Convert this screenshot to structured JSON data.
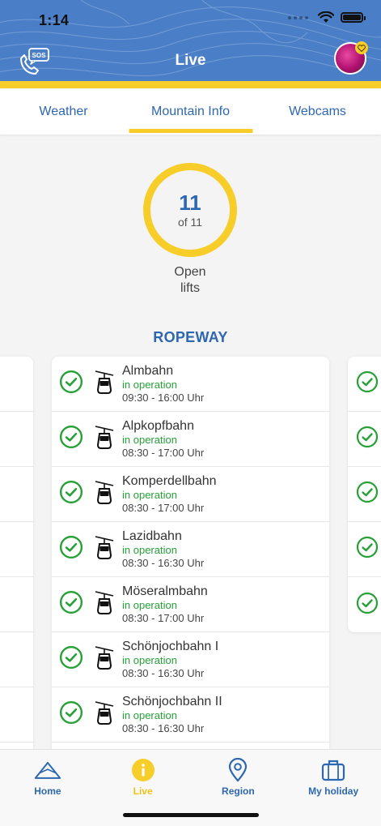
{
  "status_bar": {
    "time": "1:14"
  },
  "header": {
    "title": "Live",
    "sos_label": "SOS"
  },
  "tabs": [
    {
      "label": "Weather"
    },
    {
      "label": "Mountain Info"
    },
    {
      "label": "Webcams"
    }
  ],
  "summary": {
    "open_count": "11",
    "total_text": "of 11",
    "label_line1": "Open",
    "label_line2": "lifts"
  },
  "section": {
    "title": "ROPEWAY"
  },
  "lifts": [
    {
      "name": "Almbahn",
      "status": "in operation",
      "hours": "09:30 - 16:00 Uhr"
    },
    {
      "name": "Alpkopfbahn",
      "status": "in operation",
      "hours": "08:30 - 17:00 Uhr"
    },
    {
      "name": "Komperdellbahn",
      "status": "in operation",
      "hours": "08:30 - 17:00 Uhr"
    },
    {
      "name": "Lazidbahn",
      "status": "in operation",
      "hours": "08:30 - 16:30 Uhr"
    },
    {
      "name": "Möseralmbahn",
      "status": "in operation",
      "hours": "08:30 - 17:00 Uhr"
    },
    {
      "name": "Schönjochbahn I",
      "status": "in operation",
      "hours": "08:30 - 16:30 Uhr"
    },
    {
      "name": "Schönjochbahn II",
      "status": "in operation",
      "hours": "08:30 - 16:30 Uhr"
    }
  ],
  "bottom_nav": [
    {
      "label": "Home",
      "icon": "mountain-icon"
    },
    {
      "label": "Live",
      "icon": "info-icon"
    },
    {
      "label": "Region",
      "icon": "location-pin-icon"
    },
    {
      "label": "My holiday",
      "icon": "suitcase-icon"
    }
  ],
  "colors": {
    "primary": "#2d67b0",
    "header": "#4a7fc8",
    "accent": "#f7cd2a",
    "status_ok": "#27a037"
  }
}
